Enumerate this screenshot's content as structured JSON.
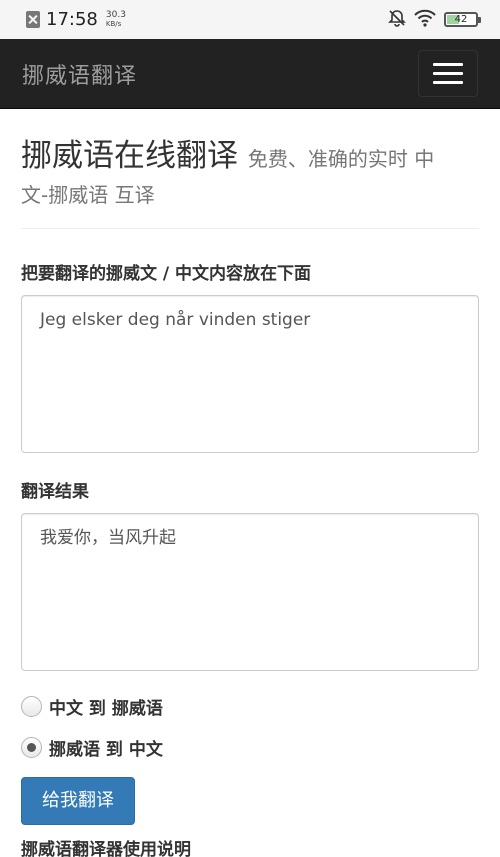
{
  "status_bar": {
    "time": "17:58",
    "net_speed_value": "30.3",
    "net_speed_unit": "KB/s",
    "battery_level": "42",
    "icons": [
      "sim-icon",
      "mute-icon",
      "wifi-icon",
      "battery-icon"
    ]
  },
  "navbar": {
    "brand": "挪威语翻译",
    "menu_icon": "hamburger-menu-icon"
  },
  "header": {
    "title": "挪威语在线翻译",
    "subtitle_part1": "免费、准确的实时 中",
    "subtitle_part2": "文-挪威语 互译"
  },
  "form": {
    "input_label": "把要翻译的挪威文 / 中文内容放在下面",
    "input_value": "Jeg elsker deg når vinden stiger",
    "result_label": "翻译结果",
    "result_value": "我爱你，当风升起",
    "direction_options": [
      {
        "label": "中文 到 挪威语",
        "checked": false
      },
      {
        "label": "挪威语 到 中文",
        "checked": true
      }
    ],
    "submit_label": "给我翻译"
  },
  "footer": {
    "instructions_title": "挪威语翻译器使用说明"
  },
  "colors": {
    "navbar_bg": "#222222",
    "brand_text": "#9d9d9d",
    "primary_button": "#337ab7"
  }
}
